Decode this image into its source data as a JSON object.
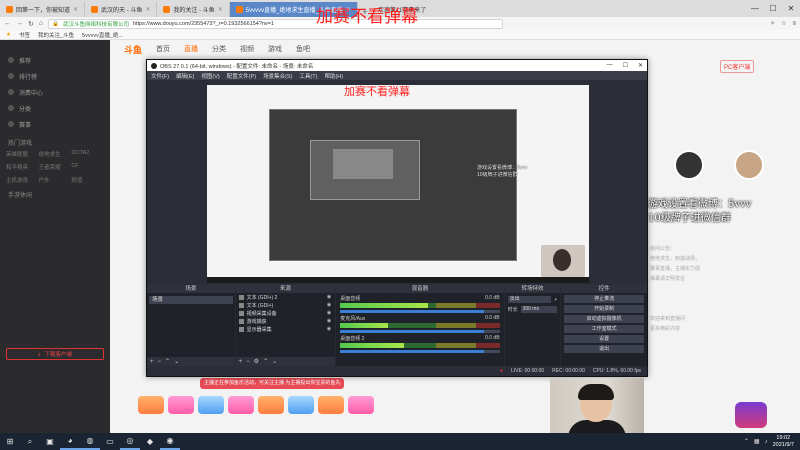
{
  "browser": {
    "tabs": [
      {
        "label": "回第一下，你被知道",
        "active": false
      },
      {
        "label": "武汉的天 - 斗鱼",
        "active": false
      },
      {
        "label": "我的关注 - 斗鱼",
        "active": false
      },
      {
        "label": "5vvvvv直播_绝地求生直播_斗鱼直播",
        "active": true
      }
    ],
    "tab_right_text": "欢迎第11赛事来了",
    "url_site": "武汉斗鱼网络科技有限公司",
    "url": "https://www.douyu.com/2355473?_r=0.1932566154?nv=1",
    "bookmarks": [
      "书签",
      "我的关注_斗鱼",
      "5vvvvv直播_绝..."
    ]
  },
  "colors": {
    "danmu": "#ff1e1e",
    "accent": "#ff6a00",
    "obs_bg": "#2b2e38",
    "taskbar": "#1b2432",
    "active_tab": "#5a87c8"
  },
  "douyu": {
    "nav": [
      "斗鱼",
      "首页",
      "直播",
      "分类",
      "视频",
      "游戏",
      "鱼吧"
    ],
    "sidebar_items": [
      "推荐",
      "排行榜",
      "消费中心",
      "分类",
      "赛事"
    ],
    "sidebar_section1": "热门游戏",
    "sidebar_games": [
      "英雄联盟",
      "绝地求生",
      "DOTA2",
      "和平精英",
      "王者荣耀",
      "CF",
      "主机游戏",
      "户外",
      "颜值"
    ],
    "sidebar_section2": "手游休闲",
    "sidebar_button": "下载客户端",
    "pc_badge": "PC客户端",
    "gift_tip": "主播正在参加鱼乐活动，可关注主播\n为主播投出你宝贵的鱼丸",
    "right_lines": [
      "房间公告：",
      "绝地求生，刺激战场，",
      "赛事直播，主播实力强",
      "弹幕请文明发言",
      "欢迎来到直播间",
      "更多精彩内容"
    ],
    "weibo_overlay": [
      "游戏设置看微博：5vvv",
      "10级牌子进微信群"
    ]
  },
  "danmu": {
    "top": "加赛不看弹幕",
    "second": "加赛不看弹幕"
  },
  "obs": {
    "title": "OBS 27.0.1 (64-bit, windows) - 配置文件: 未命名 - 场景: 未命名",
    "menu": [
      "文件(F)",
      "编辑(E)",
      "视图(V)",
      "配置文件(P)",
      "场景集合(S)",
      "工具(T)",
      "帮助(H)"
    ],
    "preview_text": [
      "游戏设置看微博：5vvv",
      "10级牌子进微信群"
    ],
    "docks": {
      "scenes": "场景",
      "sources": "来源",
      "mixer": "混音器",
      "transitions": "转场特效",
      "controls": "控件"
    },
    "scene_items": [
      "场景"
    ],
    "source_items": [
      "文本 (GDI+) 2",
      "文本 (GDI+)",
      "视频采集设备",
      "游戏捕获",
      "显示器采集"
    ],
    "mixer_tracks": [
      {
        "name": "桌面音频",
        "db": "0.0 dB",
        "level": 0.55,
        "volume": 0.9
      },
      {
        "name": "麦克风/Aux",
        "db": "0.0 dB",
        "level": 0.3,
        "volume": 0.9
      },
      {
        "name": "桌面音频 2",
        "db": "0.0 dB",
        "level": 0.4,
        "volume": 0.9
      }
    ],
    "transition_type": "淡出",
    "duration_label": "时长",
    "duration_value": "300 ms",
    "controls": [
      "停止推流",
      "开始录制",
      "启动虚拟摄像机",
      "工作室模式",
      "设置",
      "退出"
    ],
    "status": {
      "live_label": "LIVE: 00:00:00",
      "rec_label": "REC: 00:00:00",
      "cpu": "CPU: 1.8%, 60.00 fps"
    }
  },
  "taskbar": {
    "time": "19:02",
    "date": "2021/9/7"
  }
}
